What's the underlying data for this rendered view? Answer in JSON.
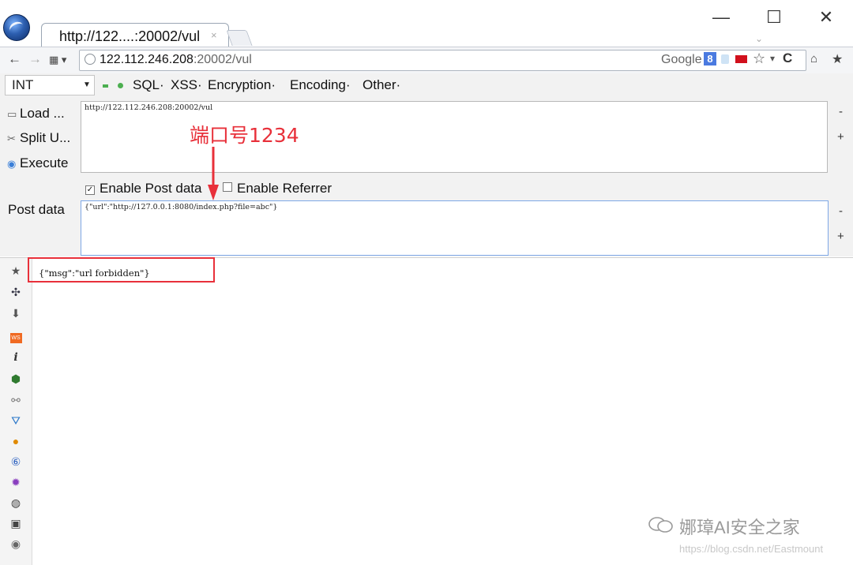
{
  "window": {
    "tab_title": "http://122....:20002/vul",
    "tab_close": "×",
    "minimize": "—",
    "maximize": "☐",
    "close": "✕"
  },
  "nav": {
    "back": "←",
    "forward": "→",
    "url_host": "122.112.246.208",
    "url_rest": ":20002/vul",
    "search_engine": "Google",
    "search_badge": "8",
    "bookmark_star": "☆",
    "reload": "C",
    "home": "🏠",
    "bookmarks": "★"
  },
  "hackbar": {
    "select_value": "INT",
    "menus": [
      "SQL·",
      "XSS·",
      "Encryption·",
      "Encoding·",
      "Other·"
    ],
    "load_label": "Load ...",
    "split_label": "Split U...",
    "execute_label": "Execute",
    "url_value": "http://122.112.246.208:20002/vul",
    "enable_post_label": "Enable Post data",
    "enable_referrer_label": "Enable Referrer",
    "post_label": "Post data",
    "post_value": "{\"url\":\"http://127.0.0.1:8080/index.php?file=abc\"}",
    "minus": "-",
    "plus": "+"
  },
  "annotation": {
    "label": "端口号1234",
    "color": "#e8303a"
  },
  "response": {
    "text": "{\"msg\":\"url forbidden\"}"
  },
  "watermark": {
    "text": "娜璋AI安全之家",
    "url": "https://blog.csdn.net/Eastmount"
  }
}
